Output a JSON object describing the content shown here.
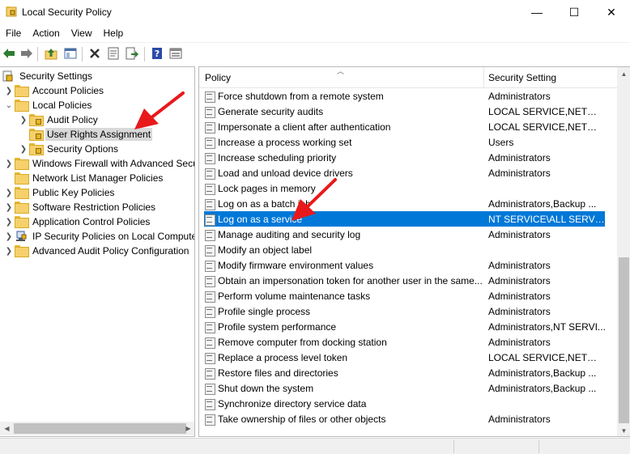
{
  "window": {
    "title": "Local Security Policy",
    "minimize_glyph": "—",
    "maximize_glyph": "☐",
    "close_glyph": "✕"
  },
  "menu": [
    "File",
    "Action",
    "View",
    "Help"
  ],
  "toolbar": {
    "buttons": [
      "back-arrow-icon",
      "forward-arrow-icon",
      "up-folder-icon",
      "show-hide-tree-icon",
      "delete-icon",
      "properties-icon",
      "export-list-icon",
      "help-icon",
      "console-view-icon"
    ]
  },
  "tree": {
    "root": "Security Settings",
    "items": [
      {
        "label": "Account Policies",
        "expanded": false
      },
      {
        "label": "Local Policies",
        "expanded": true
      },
      {
        "label": "Audit Policy",
        "expanded": false
      },
      {
        "label": "User Rights Assignment",
        "selected": true
      },
      {
        "label": "Security Options",
        "expanded": false
      },
      {
        "label": "Windows Firewall with Advanced Secu",
        "expanded": false
      },
      {
        "label": "Network List Manager Policies"
      },
      {
        "label": "Public Key Policies",
        "expanded": false
      },
      {
        "label": "Software Restriction Policies",
        "expanded": false
      },
      {
        "label": "Application Control Policies",
        "expanded": false
      },
      {
        "label": "IP Security Policies on Local Compute",
        "expanded": false
      },
      {
        "label": "Advanced Audit Policy Configuration",
        "expanded": false
      }
    ]
  },
  "list": {
    "columns": {
      "policy": "Policy",
      "setting": "Security Setting"
    },
    "rows": [
      {
        "policy": "Force shutdown from a remote system",
        "setting": "Administrators"
      },
      {
        "policy": "Generate security audits",
        "setting": "LOCAL SERVICE,NETWO..."
      },
      {
        "policy": "Impersonate a client after authentication",
        "setting": "LOCAL SERVICE,NETWO..."
      },
      {
        "policy": "Increase a process working set",
        "setting": "Users"
      },
      {
        "policy": "Increase scheduling priority",
        "setting": "Administrators"
      },
      {
        "policy": "Load and unload device drivers",
        "setting": "Administrators"
      },
      {
        "policy": "Lock pages in memory",
        "setting": ""
      },
      {
        "policy": "Log on as a batch job",
        "setting": "Administrators,Backup ..."
      },
      {
        "policy": "Log on as a service",
        "setting": "NT SERVICE\\ALL SERVIC...",
        "selected": true
      },
      {
        "policy": "Manage auditing and security log",
        "setting": "Administrators"
      },
      {
        "policy": "Modify an object label",
        "setting": ""
      },
      {
        "policy": "Modify firmware environment values",
        "setting": "Administrators"
      },
      {
        "policy": "Obtain an impersonation token for another user in the same...",
        "setting": "Administrators"
      },
      {
        "policy": "Perform volume maintenance tasks",
        "setting": "Administrators"
      },
      {
        "policy": "Profile single process",
        "setting": "Administrators"
      },
      {
        "policy": "Profile system performance",
        "setting": "Administrators,NT SERVI..."
      },
      {
        "policy": "Remove computer from docking station",
        "setting": "Administrators"
      },
      {
        "policy": "Replace a process level token",
        "setting": "LOCAL SERVICE,NETWO..."
      },
      {
        "policy": "Restore files and directories",
        "setting": "Administrators,Backup ..."
      },
      {
        "policy": "Shut down the system",
        "setting": "Administrators,Backup ..."
      },
      {
        "policy": "Synchronize directory service data",
        "setting": ""
      },
      {
        "policy": "Take ownership of files or other objects",
        "setting": "Administrators"
      }
    ]
  },
  "colors": {
    "selection": "#0078d7",
    "annotation_arrow": "#e8191b"
  }
}
